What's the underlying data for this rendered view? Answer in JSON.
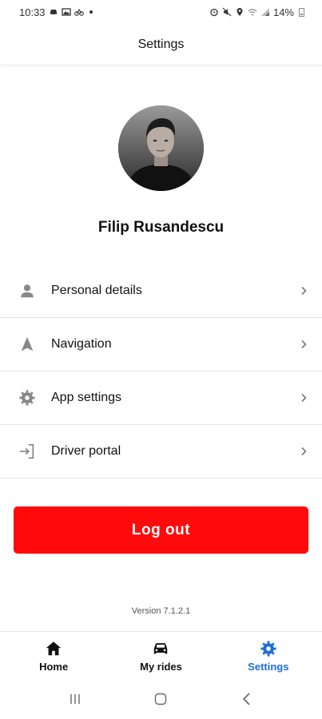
{
  "status_bar": {
    "time": "10:33",
    "battery": "14%",
    "left_icons": [
      "car-icon",
      "image-icon",
      "bike-icon"
    ],
    "right_icons": [
      "alarm-icon",
      "mute-icon",
      "location-icon",
      "wifi-icon",
      "signal-icon"
    ]
  },
  "header": {
    "title": "Settings"
  },
  "profile": {
    "name": "Filip Rusandescu",
    "avatar_icon": "user-photo"
  },
  "menu": {
    "items": [
      {
        "label": "Personal details",
        "icon": "person-icon"
      },
      {
        "label": "Navigation",
        "icon": "navigation-arrow-icon"
      },
      {
        "label": "App settings",
        "icon": "gear-icon"
      },
      {
        "label": "Driver portal",
        "icon": "login-arrow-icon"
      }
    ]
  },
  "logout": {
    "label": "Log out",
    "color": "#ff0a0a"
  },
  "version": "Version 7.1.2.1",
  "bottom_nav": {
    "items": [
      {
        "label": "Home",
        "icon": "home-icon",
        "active": false
      },
      {
        "label": "My rides",
        "icon": "car-icon",
        "active": false
      },
      {
        "label": "Settings",
        "icon": "gear-icon",
        "active": true
      }
    ],
    "active_color": "#1f6fd8"
  },
  "system_nav": [
    "recents-button",
    "home-button",
    "back-button"
  ]
}
